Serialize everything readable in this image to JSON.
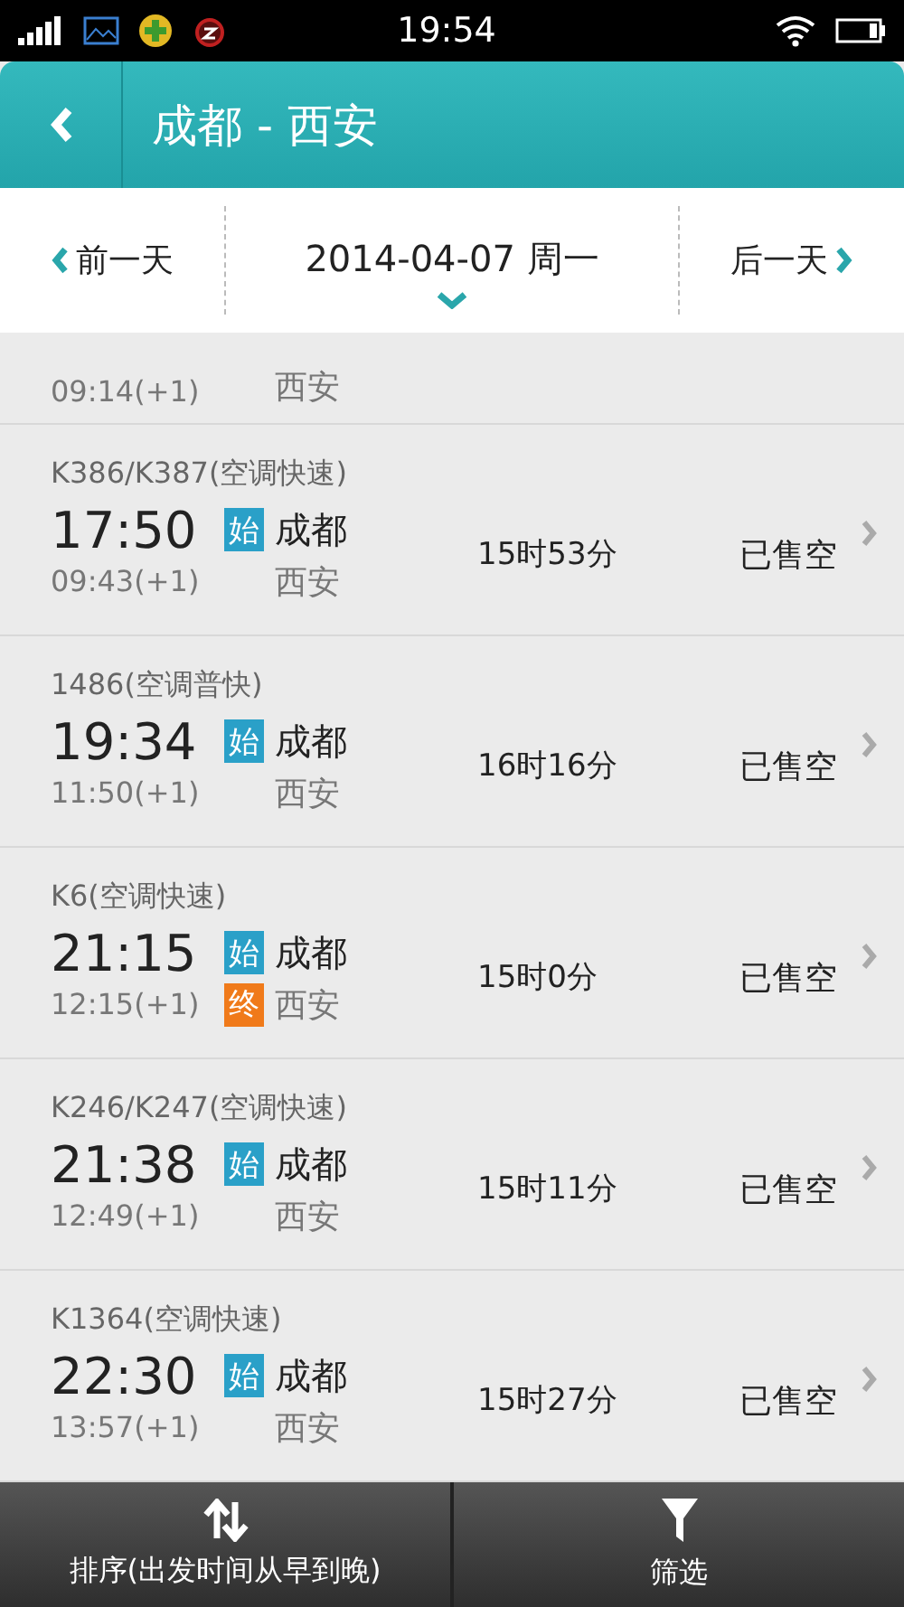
{
  "status_bar": {
    "time": "19:54"
  },
  "header": {
    "title": "成都 - 西安"
  },
  "date_bar": {
    "prev": "前一天",
    "date": "2014-04-07 周一",
    "next": "后一天"
  },
  "partial_row": {
    "arrival": "09:14(+1)",
    "to": "西安"
  },
  "trains": [
    {
      "train": "K386/K387(空调快速)",
      "depart": "17:50",
      "from_tag": "始",
      "from": "成都",
      "arrival": "09:43(+1)",
      "to": "西安",
      "duration": "15时53分",
      "status": "已售空"
    },
    {
      "train": "1486(空调普快)",
      "depart": "19:34",
      "from_tag": "始",
      "from": "成都",
      "arrival": "11:50(+1)",
      "to": "西安",
      "duration": "16时16分",
      "status": "已售空"
    },
    {
      "train": "K6(空调快速)",
      "depart": "21:15",
      "from_tag": "始",
      "from": "成都",
      "arrival": "12:15(+1)",
      "to_tag": "终",
      "to": "西安",
      "duration": "15时0分",
      "status": "已售空"
    },
    {
      "train": "K246/K247(空调快速)",
      "depart": "21:38",
      "from_tag": "始",
      "from": "成都",
      "arrival": "12:49(+1)",
      "to": "西安",
      "duration": "15时11分",
      "status": "已售空"
    },
    {
      "train": "K1364(空调快速)",
      "depart": "22:30",
      "from_tag": "始",
      "from": "成都",
      "arrival": "13:57(+1)",
      "to": "西安",
      "duration": "15时27分",
      "status": "已售空"
    }
  ],
  "bottom_bar": {
    "sort": "排序(出发时间从早到晚)",
    "filter": "筛选"
  }
}
